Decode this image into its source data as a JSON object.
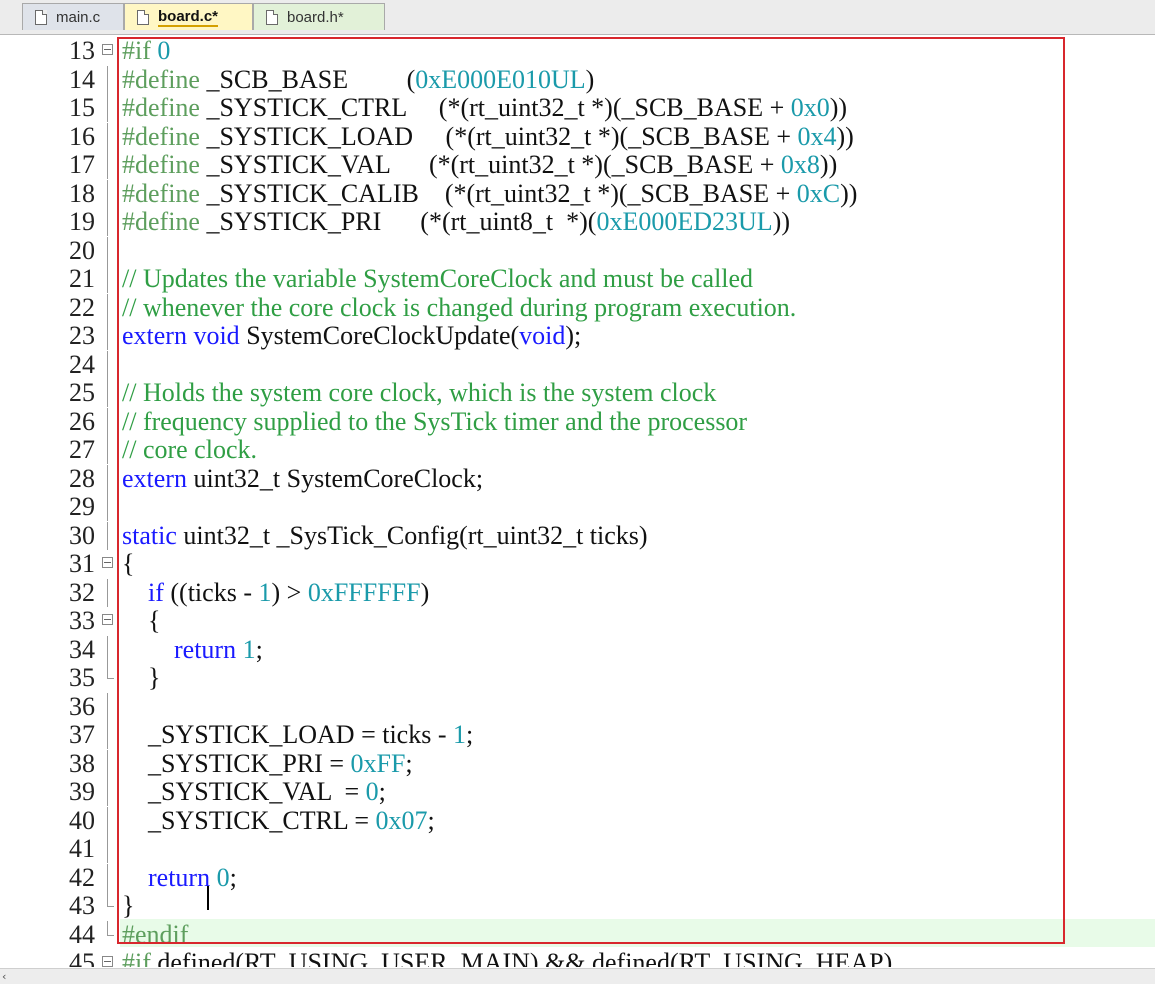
{
  "tabs": [
    {
      "label": "main.c",
      "state": "inactive"
    },
    {
      "label": "board.c*",
      "state": "active"
    },
    {
      "label": "board.h*",
      "state": "modified"
    }
  ],
  "colors": {
    "keyword": "#1a1aff",
    "preprocessor": "#5d9e5d",
    "comment": "#2f9e44",
    "number": "#1a9aaa",
    "text": "#111111",
    "annotation": "#d8272d",
    "current_line": "#e8fbe8"
  },
  "lines": [
    {
      "n": "13",
      "fold": "box",
      "tokens": [
        [
          "pp",
          "#if "
        ],
        [
          "num",
          "0"
        ]
      ]
    },
    {
      "n": "14",
      "fold": "vline",
      "tokens": [
        [
          "pp",
          "#define "
        ],
        [
          "txt",
          "_SCB_BASE         ("
        ],
        [
          "num",
          "0xE000E010UL"
        ],
        [
          "txt",
          ")"
        ]
      ]
    },
    {
      "n": "15",
      "fold": "vline",
      "tokens": [
        [
          "pp",
          "#define "
        ],
        [
          "txt",
          "_SYSTICK_CTRL     (*(rt_uint32_t *)(_SCB_BASE + "
        ],
        [
          "num",
          "0x0"
        ],
        [
          "txt",
          "))"
        ]
      ]
    },
    {
      "n": "16",
      "fold": "vline",
      "tokens": [
        [
          "pp",
          "#define "
        ],
        [
          "txt",
          "_SYSTICK_LOAD     (*(rt_uint32_t *)(_SCB_BASE + "
        ],
        [
          "num",
          "0x4"
        ],
        [
          "txt",
          "))"
        ]
      ]
    },
    {
      "n": "17",
      "fold": "vline",
      "tokens": [
        [
          "pp",
          "#define "
        ],
        [
          "txt",
          "_SYSTICK_VAL      (*(rt_uint32_t *)(_SCB_BASE + "
        ],
        [
          "num",
          "0x8"
        ],
        [
          "txt",
          "))"
        ]
      ]
    },
    {
      "n": "18",
      "fold": "vline",
      "tokens": [
        [
          "pp",
          "#define "
        ],
        [
          "txt",
          "_SYSTICK_CALIB    (*(rt_uint32_t *)(_SCB_BASE + "
        ],
        [
          "num",
          "0xC"
        ],
        [
          "txt",
          "))"
        ]
      ]
    },
    {
      "n": "19",
      "fold": "vline",
      "tokens": [
        [
          "pp",
          "#define "
        ],
        [
          "txt",
          "_SYSTICK_PRI      (*(rt_uint8_t  *)("
        ],
        [
          "num",
          "0xE000ED23UL"
        ],
        [
          "txt",
          "))"
        ]
      ]
    },
    {
      "n": "20",
      "fold": "vline",
      "tokens": []
    },
    {
      "n": "21",
      "fold": "vline",
      "tokens": [
        [
          "cm",
          "// Updates the variable SystemCoreClock and must be called"
        ]
      ]
    },
    {
      "n": "22",
      "fold": "vline",
      "tokens": [
        [
          "cm",
          "// whenever the core clock is changed during program execution."
        ]
      ]
    },
    {
      "n": "23",
      "fold": "vline",
      "tokens": [
        [
          "kw",
          "extern void "
        ],
        [
          "txt",
          "SystemCoreClockUpdate("
        ],
        [
          "kw",
          "void"
        ],
        [
          "txt",
          ");"
        ]
      ]
    },
    {
      "n": "24",
      "fold": "vline",
      "tokens": []
    },
    {
      "n": "25",
      "fold": "vline",
      "tokens": [
        [
          "cm",
          "// Holds the system core clock, which is the system clock"
        ]
      ]
    },
    {
      "n": "26",
      "fold": "vline",
      "tokens": [
        [
          "cm",
          "// frequency supplied to the SysTick timer and the processor"
        ]
      ]
    },
    {
      "n": "27",
      "fold": "vline",
      "tokens": [
        [
          "cm",
          "// core clock."
        ]
      ]
    },
    {
      "n": "28",
      "fold": "vline",
      "tokens": [
        [
          "kw",
          "extern "
        ],
        [
          "txt",
          "uint32_t SystemCoreClock;"
        ]
      ]
    },
    {
      "n": "29",
      "fold": "vline",
      "tokens": []
    },
    {
      "n": "30",
      "fold": "vline",
      "tokens": [
        [
          "kw",
          "static "
        ],
        [
          "txt",
          "uint32_t _SysTick_Config(rt_uint32_t ticks)"
        ]
      ]
    },
    {
      "n": "31",
      "fold": "box",
      "tokens": [
        [
          "txt",
          "{"
        ]
      ]
    },
    {
      "n": "32",
      "fold": "vline",
      "tokens": [
        [
          "txt",
          "    "
        ],
        [
          "kw",
          "if "
        ],
        [
          "txt",
          "((ticks - "
        ],
        [
          "num",
          "1"
        ],
        [
          "txt",
          ") > "
        ],
        [
          "num",
          "0xFFFFFF"
        ],
        [
          "txt",
          ")"
        ]
      ]
    },
    {
      "n": "33",
      "fold": "box",
      "tokens": [
        [
          "txt",
          "    {"
        ]
      ]
    },
    {
      "n": "34",
      "fold": "vline",
      "tokens": [
        [
          "txt",
          "        "
        ],
        [
          "kw",
          "return "
        ],
        [
          "num",
          "1"
        ],
        [
          "txt",
          ";"
        ]
      ]
    },
    {
      "n": "35",
      "fold": "end",
      "tokens": [
        [
          "txt",
          "    }"
        ]
      ]
    },
    {
      "n": "36",
      "fold": "vline",
      "tokens": []
    },
    {
      "n": "37",
      "fold": "vline",
      "tokens": [
        [
          "txt",
          "    _SYSTICK_LOAD = ticks - "
        ],
        [
          "num",
          "1"
        ],
        [
          "txt",
          ";"
        ]
      ]
    },
    {
      "n": "38",
      "fold": "vline",
      "tokens": [
        [
          "txt",
          "    _SYSTICK_PRI = "
        ],
        [
          "num",
          "0xFF"
        ],
        [
          "txt",
          ";"
        ]
      ]
    },
    {
      "n": "39",
      "fold": "vline",
      "tokens": [
        [
          "txt",
          "    _SYSTICK_VAL  = "
        ],
        [
          "num",
          "0"
        ],
        [
          "txt",
          ";"
        ]
      ]
    },
    {
      "n": "40",
      "fold": "vline",
      "tokens": [
        [
          "txt",
          "    _SYSTICK_CTRL = "
        ],
        [
          "num",
          "0x07"
        ],
        [
          "txt",
          ";"
        ]
      ]
    },
    {
      "n": "41",
      "fold": "vline",
      "tokens": []
    },
    {
      "n": "42",
      "fold": "vline",
      "tokens": [
        [
          "txt",
          "    "
        ],
        [
          "kw",
          "return "
        ],
        [
          "num",
          "0"
        ],
        [
          "txt",
          ";"
        ]
      ]
    },
    {
      "n": "43",
      "fold": "end",
      "tokens": [
        [
          "txt",
          "}"
        ]
      ]
    },
    {
      "n": "44",
      "fold": "end",
      "tokens": [
        [
          "pp",
          "#endif"
        ]
      ]
    },
    {
      "n": "45",
      "fold": "box",
      "tokens": [
        [
          "pp",
          "#if "
        ],
        [
          "txt",
          "defined(RT_USING_USER_MAIN) && defined(RT_USING_HEAP)"
        ]
      ]
    }
  ]
}
